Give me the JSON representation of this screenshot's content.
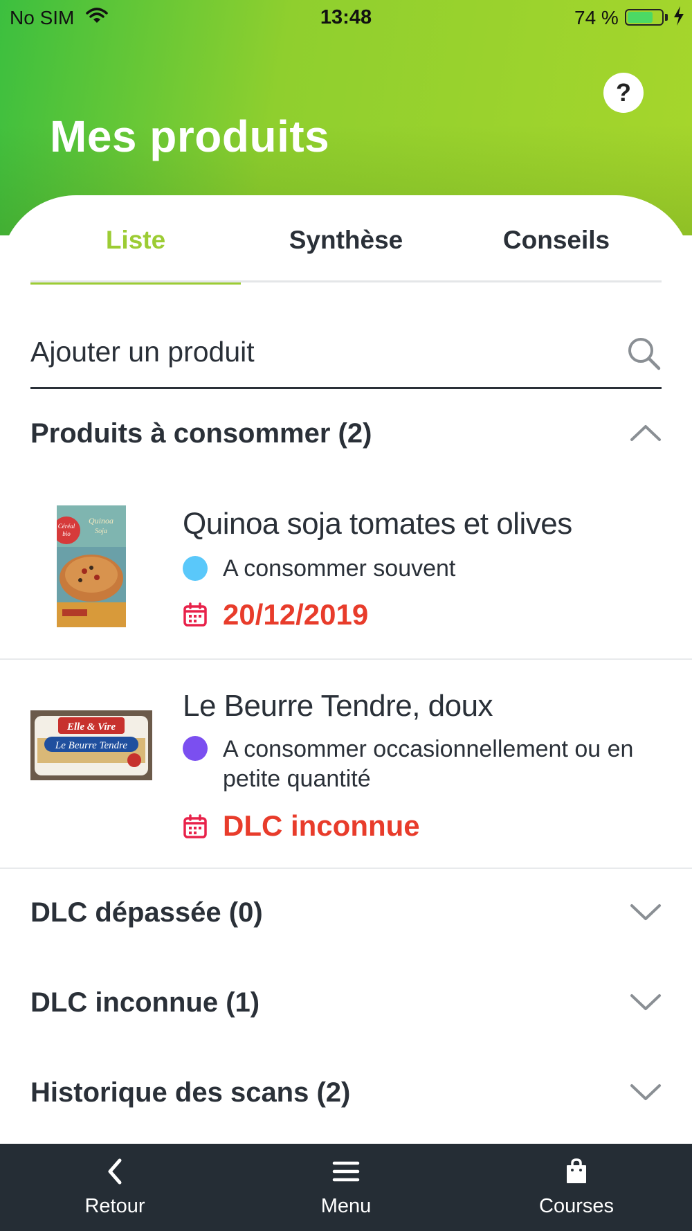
{
  "status_bar": {
    "carrier": "No SIM",
    "time": "13:48",
    "battery_percent": "74 %",
    "battery_level": 0.74
  },
  "header": {
    "title": "Mes produits",
    "help_label": "?"
  },
  "tabs": [
    {
      "label": "Liste",
      "active": true
    },
    {
      "label": "Synthèse",
      "active": false
    },
    {
      "label": "Conseils",
      "active": false
    }
  ],
  "search": {
    "placeholder": "Ajouter un produit"
  },
  "sections": [
    {
      "label": "Produits à consommer (2)",
      "expanded": true
    },
    {
      "label": "DLC dépassée (0)",
      "expanded": false
    },
    {
      "label": "DLC inconnue (1)",
      "expanded": false
    },
    {
      "label": "Historique des scans (2)",
      "expanded": false
    }
  ],
  "products": [
    {
      "name": "Quinoa soja tomates et olives",
      "frequency": "A consommer souvent",
      "frequency_color": "#5ac8fa",
      "date": "20/12/2019",
      "image_text": [
        "Céréal bio",
        "Quinoa",
        "Soja"
      ]
    },
    {
      "name": "Le Beurre Tendre, doux",
      "frequency": "A consommer occasionnellement ou en petite quantité",
      "frequency_color": "#7b4ff0",
      "date": "DLC inconnue",
      "image_text": [
        "Elle & Vire",
        "Le Beurre Tendre"
      ]
    }
  ],
  "bottom_nav": [
    {
      "label": "Retour",
      "icon": "chevron-left-icon"
    },
    {
      "label": "Menu",
      "icon": "menu-icon"
    },
    {
      "label": "Courses",
      "icon": "shopping-bag-icon"
    }
  ],
  "colors": {
    "accent": "#9ccc34",
    "date_red": "#e83c2b",
    "calendar_pink": "#e8224a",
    "nav_bg": "#252d35"
  }
}
